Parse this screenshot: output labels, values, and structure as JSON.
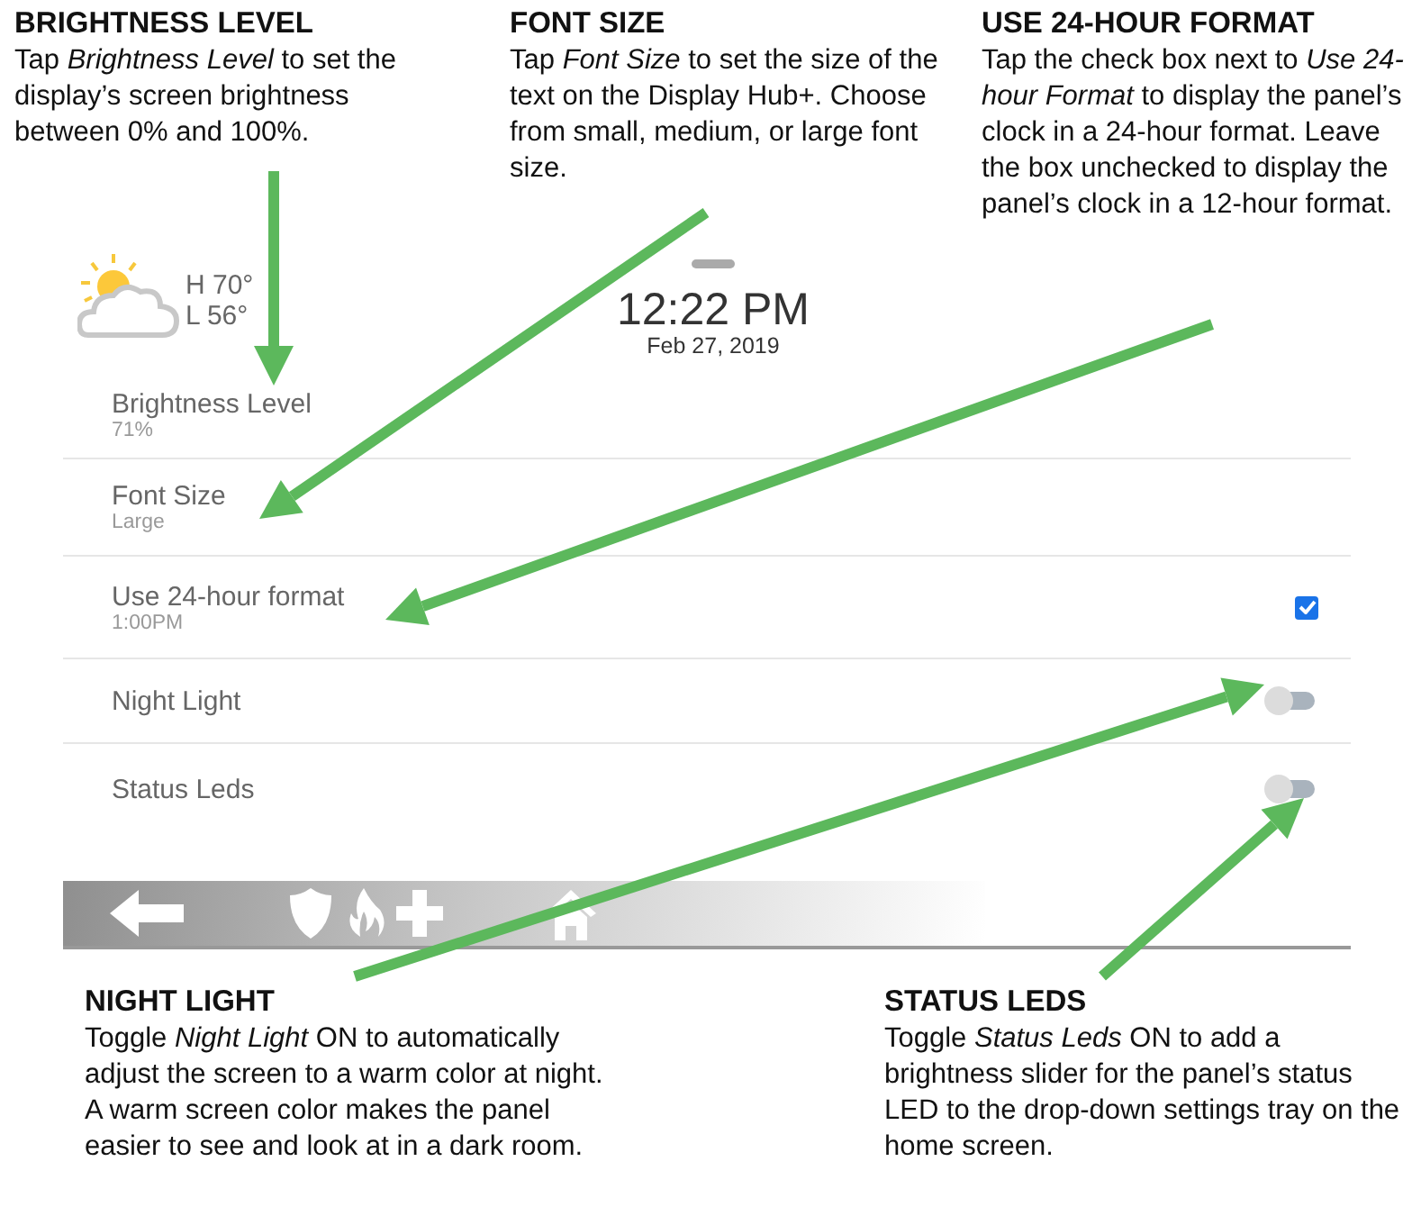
{
  "top_notes": [
    {
      "title": "BRIGHTNESS LEVEL",
      "text": "Tap *Brightness Level* to set the display’s screen brightness between 0% and 100%."
    },
    {
      "title": "FONT SIZE",
      "text": "Tap *Font Size* to set the size of the text on the Display Hub+. Choose from small, medium, or large font size."
    },
    {
      "title": "USE 24-HOUR FORMAT",
      "text": "Tap the check box next to *Use 24-hour Format* to display the panel’s clock in a 24-hour format. Leave the box unchecked to display the panel’s clock in a 12-hour format."
    }
  ],
  "panel": {
    "weather": {
      "high": "H 70°",
      "low": "L 56°"
    },
    "time": "12:22 PM",
    "date": "Feb 27, 2019",
    "settings": [
      {
        "kind": "value",
        "label": "Brightness Level",
        "value": "71%"
      },
      {
        "kind": "value",
        "label": "Font Size",
        "value": "Large"
      },
      {
        "kind": "checkbox",
        "label": "Use 24-hour format",
        "value": "1:00PM",
        "checked": true
      },
      {
        "kind": "toggle",
        "label": "Night Light",
        "on": false
      },
      {
        "kind": "toggle",
        "label": "Status Leds",
        "on": false
      }
    ]
  },
  "bottom_notes": [
    {
      "title": "NIGHT LIGHT",
      "text": "Toggle *Night Light* ON to automatically adjust the screen to a warm color at night. A warm screen color makes the panel easier to see and look at in a dark room."
    },
    {
      "title": "STATUS LEDS",
      "text": "Toggle *Status Leds* ON to add a brightness slider for the panel’s status LED to the drop-down settings tray on the home screen."
    }
  ]
}
